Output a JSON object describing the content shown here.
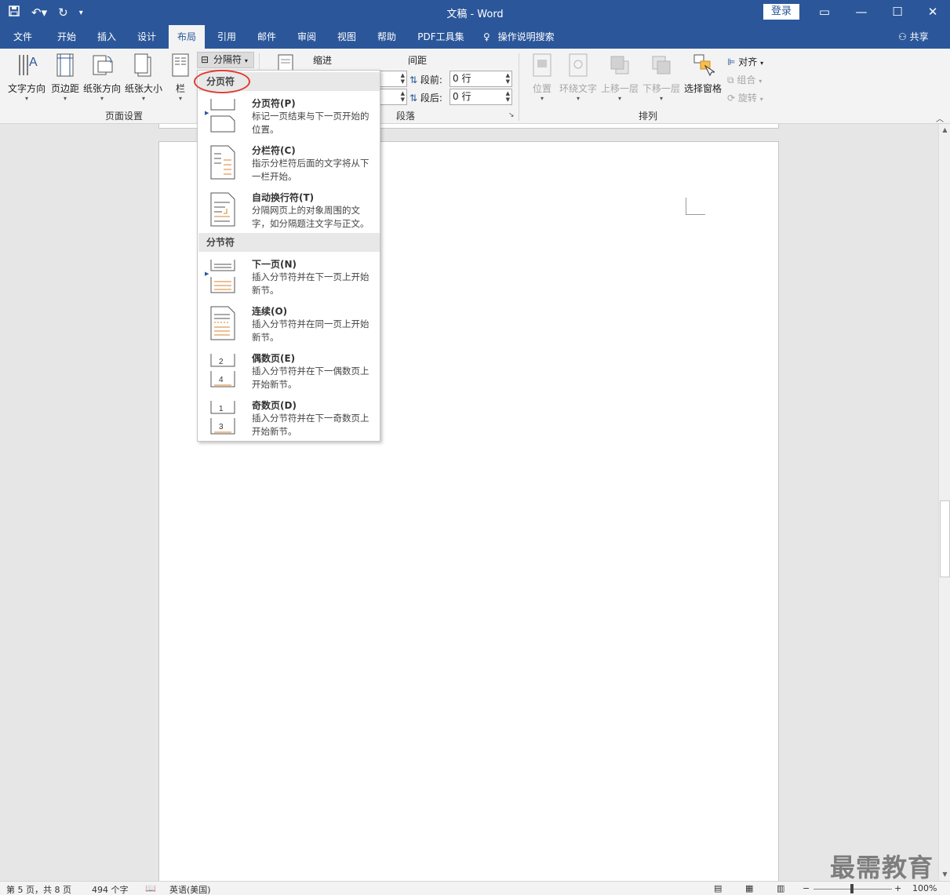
{
  "window": {
    "title": "文稿  -  Word",
    "login_label": "登录",
    "share_label": "共享"
  },
  "tabs": [
    {
      "label": "文件"
    },
    {
      "label": "开始"
    },
    {
      "label": "插入"
    },
    {
      "label": "设计"
    },
    {
      "label": "布局",
      "active": true
    },
    {
      "label": "引用"
    },
    {
      "label": "邮件"
    },
    {
      "label": "审阅"
    },
    {
      "label": "视图"
    },
    {
      "label": "帮助"
    },
    {
      "label": "PDF工具集"
    },
    {
      "label": "操作说明搜索"
    }
  ],
  "ribbon": {
    "page_setup": {
      "label": "页面设置",
      "text_direction": "文字方向",
      "margins": "页边距",
      "orientation": "纸张方向",
      "size": "纸张大小",
      "columns": "栏",
      "breaks": "分隔符"
    },
    "paragraph": {
      "label": "段落",
      "indent_title": "缩进",
      "spacing_title": "间距",
      "before_label": "段前:",
      "before_value": "0 行",
      "after_label": "段后:",
      "after_value": "0 行"
    },
    "arrange": {
      "label": "排列",
      "position": "位置",
      "wrap_text": "环绕文字",
      "bring_forward": "上移一层",
      "send_backward": "下移一层",
      "selection_pane": "选择窗格",
      "align": "对齐",
      "group": "组合",
      "rotate": "旋转"
    }
  },
  "breaks_menu": {
    "page_breaks_header": "分页符",
    "section_breaks_header": "分节符",
    "items": [
      {
        "title": "分页符(P)",
        "desc": "标记一页结束与下一页开始的位置。",
        "icon": "page-break-icon"
      },
      {
        "title": "分栏符(C)",
        "desc": "指示分栏符后面的文字将从下一栏开始。",
        "icon": "column-break-icon"
      },
      {
        "title": "自动换行符(T)",
        "desc": "分隔网页上的对象周围的文字，如分隔题注文字与正文。",
        "icon": "text-wrapping-break-icon"
      },
      {
        "title": "下一页(N)",
        "desc": "插入分节符并在下一页上开始新节。",
        "icon": "next-page-section-icon"
      },
      {
        "title": "连续(O)",
        "desc": "插入分节符并在同一页上开始新节。",
        "icon": "continuous-section-icon"
      },
      {
        "title": "偶数页(E)",
        "desc": "插入分节符并在下一偶数页上开始新节。",
        "icon": "even-page-section-icon"
      },
      {
        "title": "奇数页(D)",
        "desc": "插入分节符并在下一奇数页上开始新节。",
        "icon": "odd-page-section-icon"
      }
    ]
  },
  "status": {
    "page": "第 5 页，共 8 页",
    "words": "494 个字",
    "language": "英语(美国)",
    "zoom": "100%"
  },
  "watermark": "最需教育",
  "colors": {
    "brand": "#2b579a",
    "highlight_circle": "#e03c31",
    "icon_accent": "#d9822b"
  }
}
